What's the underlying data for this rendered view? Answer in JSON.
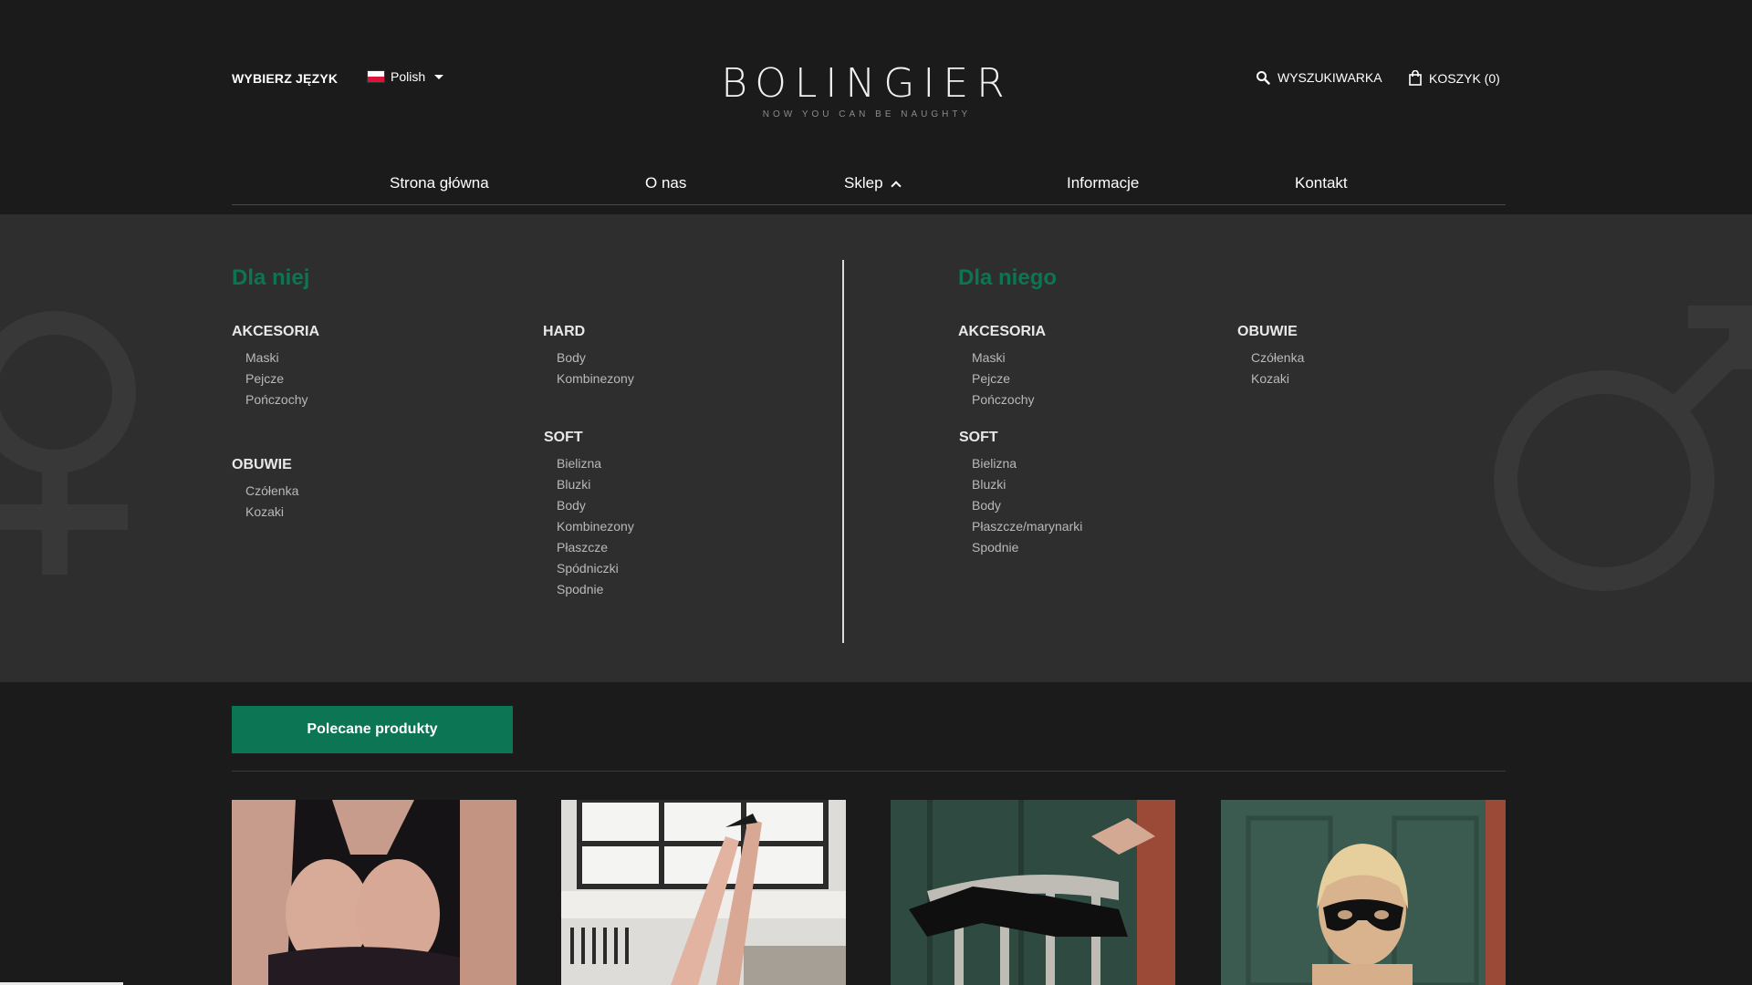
{
  "header": {
    "lang_label": "WYBIERZ JĘZYK",
    "lang_value": "Polish",
    "logo_title": "BOLINGIER",
    "logo_tagline": "NOW YOU CAN BE NAUGHTY",
    "search_label": "WYSZUKIWARKA",
    "cart_label": "KOSZYK (0)"
  },
  "nav": {
    "items": [
      {
        "label": "Strona główna"
      },
      {
        "label": "O nas"
      },
      {
        "label": "Sklep"
      },
      {
        "label": "Informacje"
      },
      {
        "label": "Kontakt"
      }
    ]
  },
  "mega": {
    "her": {
      "title": "Dla niej",
      "akcesoria": {
        "title": "AKCESORIA",
        "items": [
          "Maski",
          "Pejcze",
          "Pończochy"
        ]
      },
      "obuwie": {
        "title": "OBUWIE",
        "items": [
          "Czółenka",
          "Kozaki"
        ]
      },
      "hard": {
        "title": "HARD",
        "items": [
          "Body",
          "Kombinezony"
        ]
      },
      "soft": {
        "title": "SOFT",
        "items": [
          "Bielizna",
          "Bluzki",
          "Body",
          "Kombinezony",
          "Płaszcze",
          "Spódniczki",
          "Spodnie"
        ]
      }
    },
    "him": {
      "title": "Dla niego",
      "akcesoria": {
        "title": "AKCESORIA",
        "items": [
          "Maski",
          "Pejcze",
          "Pończochy"
        ]
      },
      "soft": {
        "title": "SOFT",
        "items": [
          "Bielizna",
          "Bluzki",
          "Body",
          "Płaszcze/marynarki",
          "Spodnie"
        ]
      },
      "obuwie": {
        "title": "OBUWIE",
        "items": [
          "Czółenka",
          "Kozaki"
        ]
      }
    }
  },
  "featured": {
    "label": "Polecane produkty"
  },
  "colors": {
    "accent": "#0c7553",
    "background": "#1c1b1c",
    "menu_background": "#2e2e2e"
  }
}
